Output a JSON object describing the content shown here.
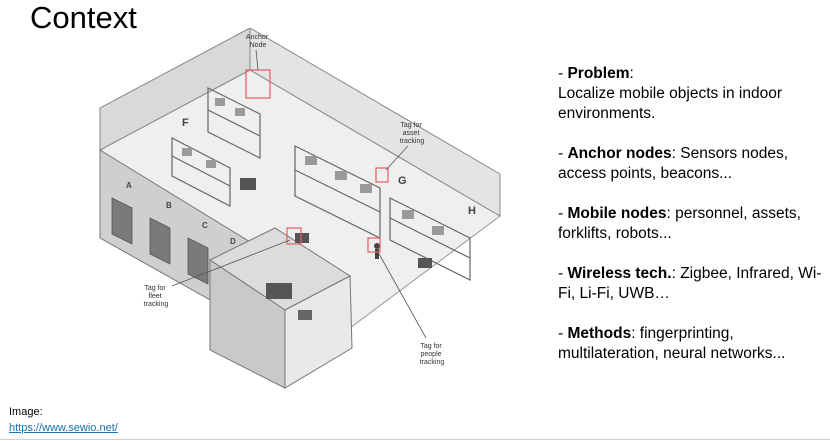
{
  "slide": {
    "title": "Context"
  },
  "illustration": {
    "callouts": {
      "anchor_node": [
        "Anchor",
        "Node"
      ],
      "asset_tag": [
        "Tag for",
        "asset",
        "tracking"
      ],
      "fleet_tag": [
        "Tag for",
        "fleet",
        "tracking"
      ],
      "people_tag": [
        "Tag for",
        "people",
        "tracking"
      ]
    },
    "wall_letters": [
      "F",
      "G",
      "H",
      "A",
      "B",
      "C",
      "D"
    ]
  },
  "bullets": [
    {
      "prefix": "- ",
      "term": "Problem",
      "sep": ":",
      "text": "Localize mobile objects in indoor environments."
    },
    {
      "prefix": "- ",
      "term": "Anchor nodes",
      "sep": ":",
      "text": " Sensors nodes, access points, beacons..."
    },
    {
      "prefix": "- ",
      "term": "Mobile nodes",
      "sep": ":",
      "text": " personnel, assets, forklifts, robots..."
    },
    {
      "prefix": "- ",
      "term": "Wireless tech.",
      "sep": ":",
      "text": " Zigbee, Infrared, Wi-Fi, Li-Fi, UWB…"
    },
    {
      "prefix": "- ",
      "term": "Methods",
      "sep": ":",
      "text": " fingerprinting, multilateration, neural networks..."
    }
  ],
  "credit": {
    "label": "Image:",
    "link": "https://www.sewio.net/"
  },
  "colors": {
    "highlight_box": "#e06060",
    "link": "#1a73a8"
  }
}
